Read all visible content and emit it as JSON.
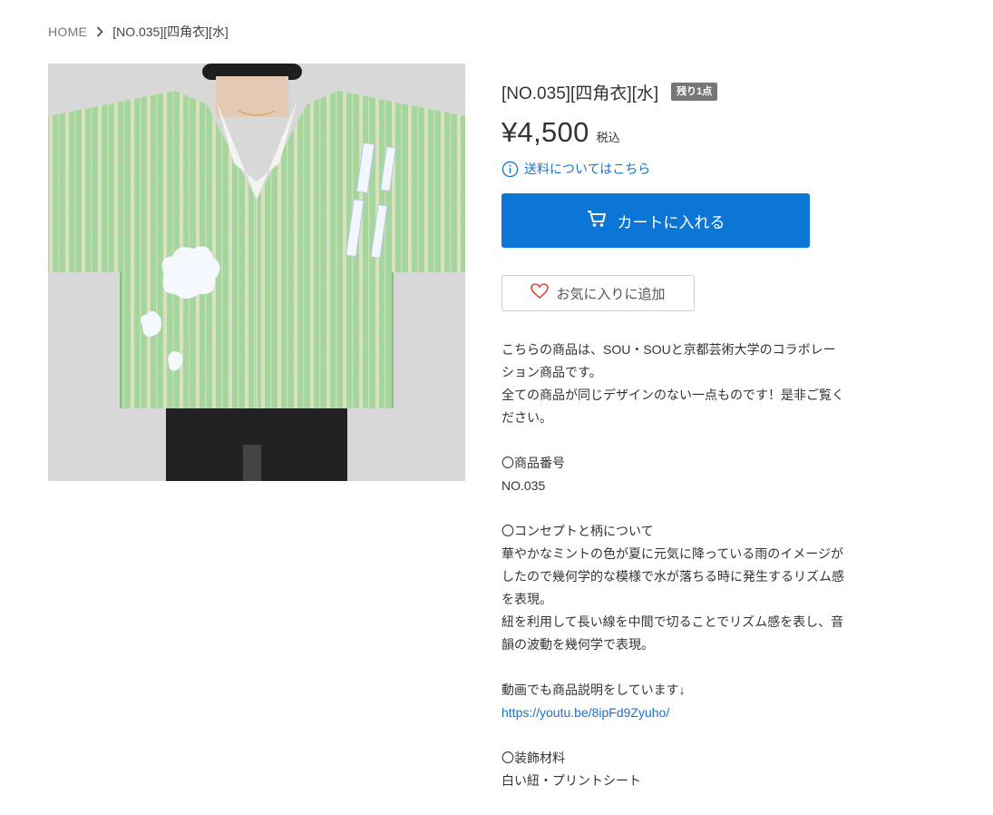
{
  "breadcrumb": {
    "home": "HOME",
    "current": "[NO.035][四角衣][水]"
  },
  "product": {
    "title": "[NO.035][四角衣][水]",
    "badge": "残り1点",
    "price": "¥4,500",
    "tax_label": "税込",
    "shipping_link": "送料についてはこちら",
    "cart_button": "カートに入れる",
    "favorite_button": "お気に入りに追加"
  },
  "description": {
    "intro_1": "こちらの商品は、SOU・SOUと京都芸術大学のコラボレーション商品です。",
    "intro_2": "全ての商品が同じデザインのない一点ものです！是非ご覧ください。",
    "number_heading": "〇商品番号",
    "number_value": "NO.035",
    "concept_heading": "〇コンセプトと柄について",
    "concept_1": "華やかなミントの色が夏に元気に降っている雨のイメージがしたので幾何学的な模様で水が落ちる時に発生するリズム感を表現。",
    "concept_2": "紐を利用して長い線を中間で切ることでリズム感を表し、音韻の波動を幾何学で表現。",
    "video_text": "動画でも商品説明をしています↓",
    "video_link": "https://youtu.be/8ipFd9Zyuho/",
    "material_heading": "〇装飾材料",
    "material_value": "白い紐・プリントシート"
  },
  "colors": {
    "accent": "#0c76d6",
    "link": "#1a73c7",
    "badge": "#777777",
    "garment": "#a8d7a0"
  },
  "icons": {
    "breadcrumb_separator": "chevron-right-icon",
    "shipping": "info-icon",
    "cart": "cart-icon",
    "favorite": "heart-icon"
  }
}
